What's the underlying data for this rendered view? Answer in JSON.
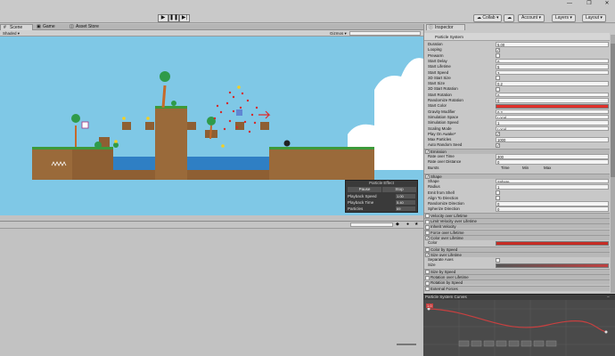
{
  "toolbar": {
    "collab": "Collab",
    "account": "Account",
    "layers": "Layers",
    "layout": "Layout",
    "play_icon": "play-icon",
    "pause_icon": "pause-icon",
    "step_icon": "step-icon"
  },
  "tabs": [
    {
      "label": "Scene"
    },
    {
      "label": "Game"
    },
    {
      "label": "Asset Store"
    }
  ],
  "scene_bar": {
    "shading": "Shaded",
    "gizmos": "Gizmos"
  },
  "particle_effect": {
    "title": "Particle Effect",
    "pause": "Pause",
    "stop": "Stop",
    "rows": [
      {
        "label": "Playback Speed",
        "value": "1.00"
      },
      {
        "label": "Playback Time",
        "value": "5.40"
      },
      {
        "label": "Particles",
        "value": "69"
      }
    ]
  },
  "inspector": {
    "tab": "Inspector",
    "component": "Particle System",
    "rows": [
      {
        "label": "Duration",
        "value": "5.00"
      },
      {
        "label": "Looping",
        "check": true
      },
      {
        "label": "Prewarm",
        "check": false
      },
      {
        "label": "Start Delay",
        "value": "0"
      },
      {
        "label": "Start Lifetime",
        "value": "5"
      },
      {
        "label": "Start Speed",
        "value": "3"
      },
      {
        "label": "3D Start Size",
        "check": false
      },
      {
        "label": "Start Size",
        "value": "0.2"
      },
      {
        "label": "3D Start Rotation",
        "check": false
      },
      {
        "label": "Start Rotation",
        "value": "0"
      },
      {
        "label": "Randomize Rotation",
        "value": "0"
      },
      {
        "label": "Start Color",
        "bar": "#e0302a"
      },
      {
        "label": "Gravity Modifier",
        "value": "0.2"
      },
      {
        "label": "Simulation Space",
        "value": "Local"
      },
      {
        "label": "Simulation Speed",
        "value": "1"
      },
      {
        "label": "Scaling Mode",
        "value": "Local"
      },
      {
        "label": "Play On Awake*",
        "check": true
      },
      {
        "label": "Max Particles",
        "value": "1000"
      },
      {
        "label": "Auto Random Seed",
        "check": true
      }
    ],
    "emission": {
      "label": "Emission",
      "rows": [
        {
          "label": "Rate over Time",
          "value": "300"
        },
        {
          "label": "Rate over Distance",
          "value": "0"
        }
      ],
      "bursts_label": "Bursts",
      "bursts_cols": [
        "Time",
        "Min",
        "Max"
      ]
    },
    "shape": {
      "label": "Shape",
      "rows": [
        {
          "label": "Shape",
          "value": "Sphere"
        },
        {
          "label": "Radius",
          "value": "1"
        },
        {
          "label": "Emit from Shell",
          "check": false
        },
        {
          "label": "Align To Direction",
          "check": false
        },
        {
          "label": "Randomize Direction",
          "value": "0"
        },
        {
          "label": "Spherize Direction",
          "value": "0"
        }
      ]
    },
    "modules_a": [
      {
        "label": "Velocity over Lifetime",
        "on": false
      },
      {
        "label": "Limit Velocity over Lifetime",
        "on": false
      },
      {
        "label": "Inherit Velocity",
        "on": false
      },
      {
        "label": "Force over Lifetime",
        "on": false
      },
      {
        "label": "Color over Lifetime",
        "on": true
      }
    ],
    "color_row": {
      "label": "Color",
      "bar": "#c72c24"
    },
    "color_by_speed": "Color by Speed",
    "size_over_lifetime": "Size over Lifetime",
    "separate_axes": "Separate Axes",
    "size_row": "Size",
    "modules_b": [
      {
        "label": "Size by Speed",
        "on": false
      },
      {
        "label": "Rotation over Lifetime",
        "on": false
      },
      {
        "label": "Rotation by Speed",
        "on": false
      },
      {
        "label": "External Forces",
        "on": false
      }
    ],
    "curves_title": "Particle System Curves",
    "curve_axis": "1.0"
  }
}
